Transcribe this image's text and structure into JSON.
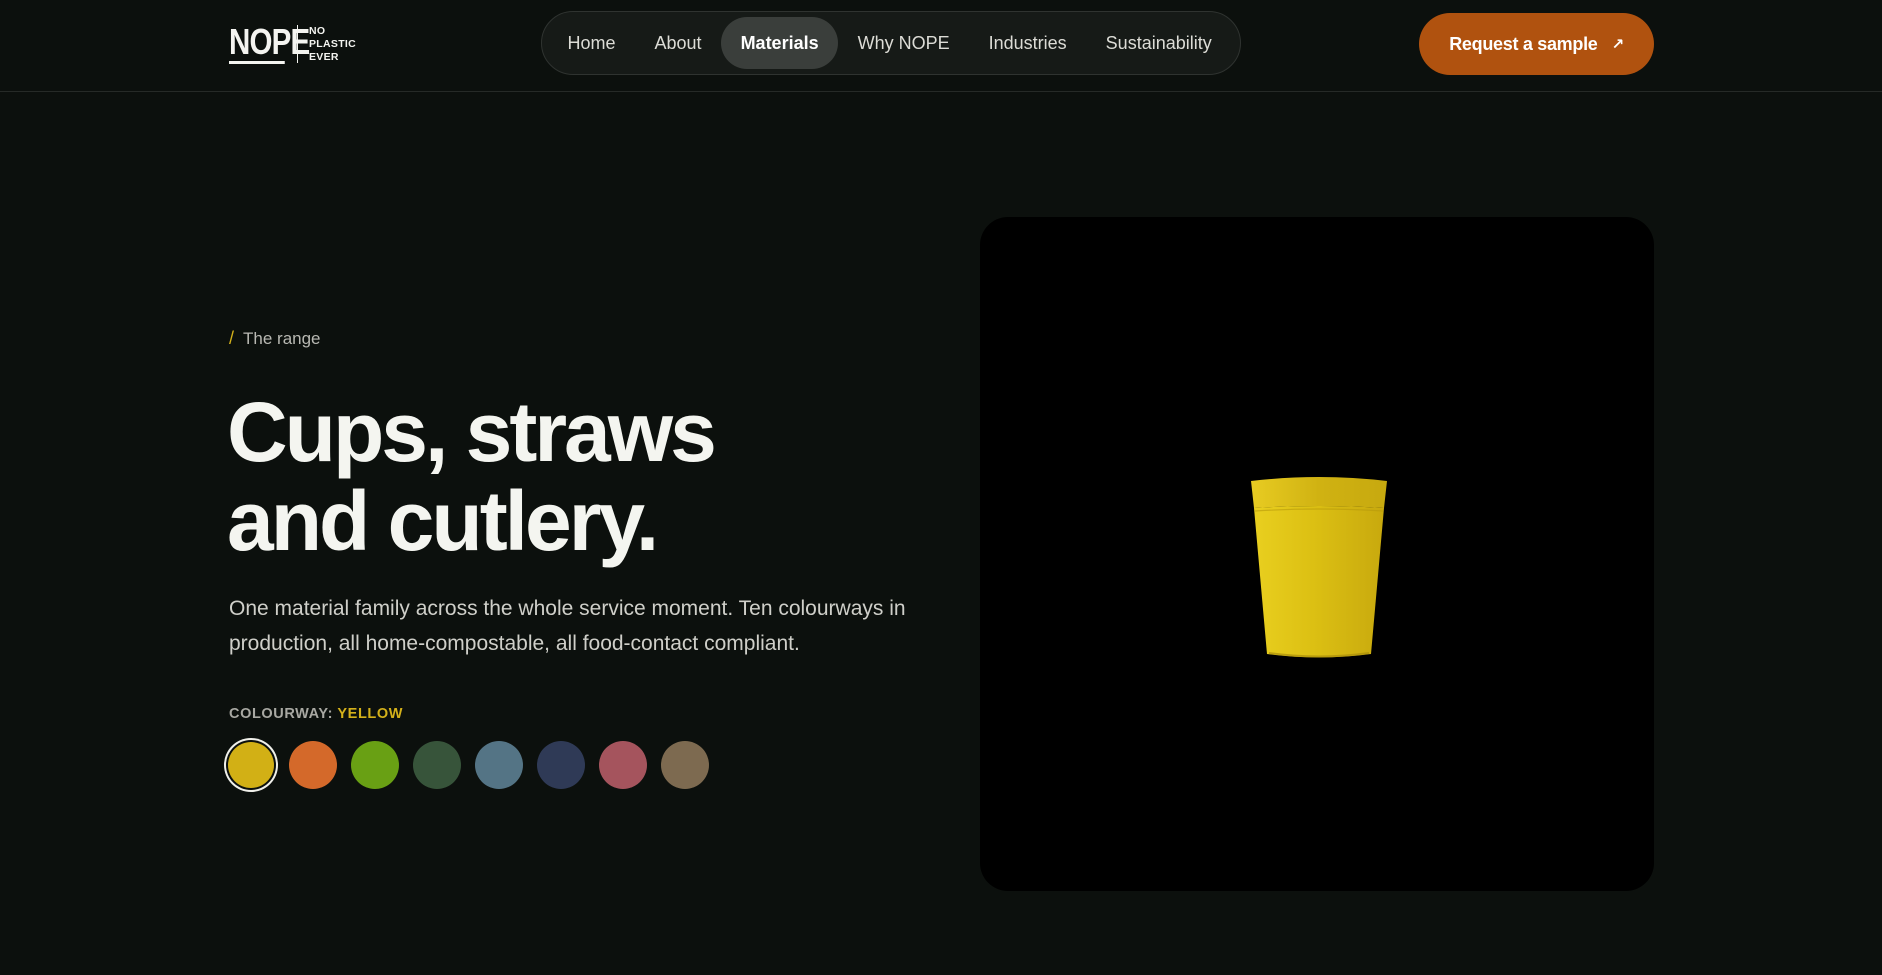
{
  "logo": {
    "word": "NOPE",
    "tag": [
      "NO",
      "PLASTIC",
      "EVER"
    ]
  },
  "nav": {
    "items": [
      {
        "label": "Home",
        "active": false
      },
      {
        "label": "About",
        "active": false
      },
      {
        "label": "Materials",
        "active": true
      },
      {
        "label": "Why NOPE",
        "active": false
      },
      {
        "label": "Industries",
        "active": false
      },
      {
        "label": "Sustainability",
        "active": false
      }
    ]
  },
  "cta": {
    "label": "Request a sample",
    "icon": "arrow-up-right-icon",
    "color": "#b0520f"
  },
  "hero": {
    "eyebrow": "The range",
    "headline": [
      "Cups, straws",
      "and cutlery."
    ],
    "description": "One material family across the whole service moment. Ten colourways in production, all home-compostable, all food-contact compliant.",
    "colourway_label": "COLOURWAY:",
    "colourway_value": "YELLOW"
  },
  "swatches": [
    {
      "color": "#d2b015",
      "selected": true
    },
    {
      "color": "#d4692a",
      "selected": false
    },
    {
      "color": "#69a014",
      "selected": false
    },
    {
      "color": "#37543a",
      "selected": false
    },
    {
      "color": "#547485",
      "selected": false
    },
    {
      "color": "#2f3a56",
      "selected": false
    },
    {
      "color": "#a5545d",
      "selected": false
    },
    {
      "color": "#7d6a50",
      "selected": false
    }
  ],
  "product": {
    "icon": "yellow-cup-image",
    "color": "#dcc013"
  },
  "colors": {
    "background": "#0c100d",
    "accent": "#d4b11a"
  }
}
